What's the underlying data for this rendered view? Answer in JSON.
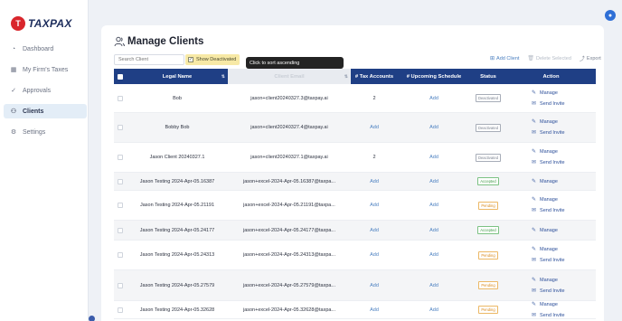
{
  "logo": {
    "mark": "T",
    "text": "TAXPAX"
  },
  "sidebar": {
    "items": [
      {
        "label": "Dashboard",
        "icon": "dashboard-icon",
        "glyph": "◔"
      },
      {
        "label": "My Firm's Taxes",
        "icon": "building-icon",
        "glyph": "▦"
      },
      {
        "label": "Approvals",
        "icon": "check-circle-icon",
        "glyph": "✓"
      },
      {
        "label": "Clients",
        "icon": "users-icon",
        "glyph": "⚇"
      },
      {
        "label": "Settings",
        "icon": "gear-icon",
        "glyph": "⚙"
      }
    ]
  },
  "user": {
    "avatar_glyph": "●"
  },
  "page": {
    "title": "Manage Clients",
    "search_placeholder": "Search Client",
    "show_deactivated_label": "Show Deactivated",
    "tooltip": "Click to sort ascending",
    "add_client": "Add Client",
    "delete_selected": "Delete Selected",
    "export": "Export"
  },
  "table": {
    "headers": {
      "legal_name": "Legal Name",
      "client_email": "Client Email",
      "tax_accounts": "# Tax Accounts",
      "upcoming_schedule": "# Upcoming Schedule",
      "status": "Status",
      "action": "Action"
    },
    "manage_label": "Manage",
    "invite_label": "Send Invite",
    "rows": [
      {
        "name": "Bob",
        "email": "jason+client20240327.3@taxpay.ai",
        "tax": "2",
        "sched": "Add",
        "status": "Deactivated",
        "invite": true
      },
      {
        "name": "Bobby Bob",
        "email": "jason+client20240327.4@taxpay.ai",
        "tax": "Add",
        "sched": "Add",
        "status": "Deactivated",
        "invite": true
      },
      {
        "name": "Jason Client 20240327.1",
        "email": "jason+client20240327.1@taxpay.ai",
        "tax": "2",
        "sched": "Add",
        "status": "Deactivated",
        "invite": true
      },
      {
        "name": "Jason Testing 2024-Apr-05.16387",
        "email": "jason+excel-2024-Apr-05.16387@taxpa...",
        "tax": "Add",
        "sched": "Add",
        "status": "Accepted",
        "invite": false
      },
      {
        "name": "Jason Testing 2024-Apr-05.21191",
        "email": "jason+excel-2024-Apr-05.21191@taxpa...",
        "tax": "Add",
        "sched": "Add",
        "status": "Pending",
        "invite": true
      },
      {
        "name": "Jason Testing 2024-Apr-05.24177",
        "email": "jason+excel-2024-Apr-05.24177@taxpa...",
        "tax": "Add",
        "sched": "Add",
        "status": "Accepted",
        "invite": false
      },
      {
        "name": "Jason Testing 2024-Apr-05.24313",
        "email": "jason+excel-2024-Apr-05.24313@taxpa...",
        "tax": "Add",
        "sched": "Add",
        "status": "Pending",
        "invite": true
      },
      {
        "name": "Jason Testing 2024-Apr-05.27579",
        "email": "jason+excel-2024-Apr-05.27579@taxpa...",
        "tax": "Add",
        "sched": "Add",
        "status": "Pending",
        "invite": true
      },
      {
        "name": "Jason Testing 2024-Apr-05.32628",
        "email": "jason+excel-2024-Apr-05.32628@taxpa...",
        "tax": "Add",
        "sched": "Add",
        "status": "Pending",
        "invite": true
      }
    ]
  }
}
